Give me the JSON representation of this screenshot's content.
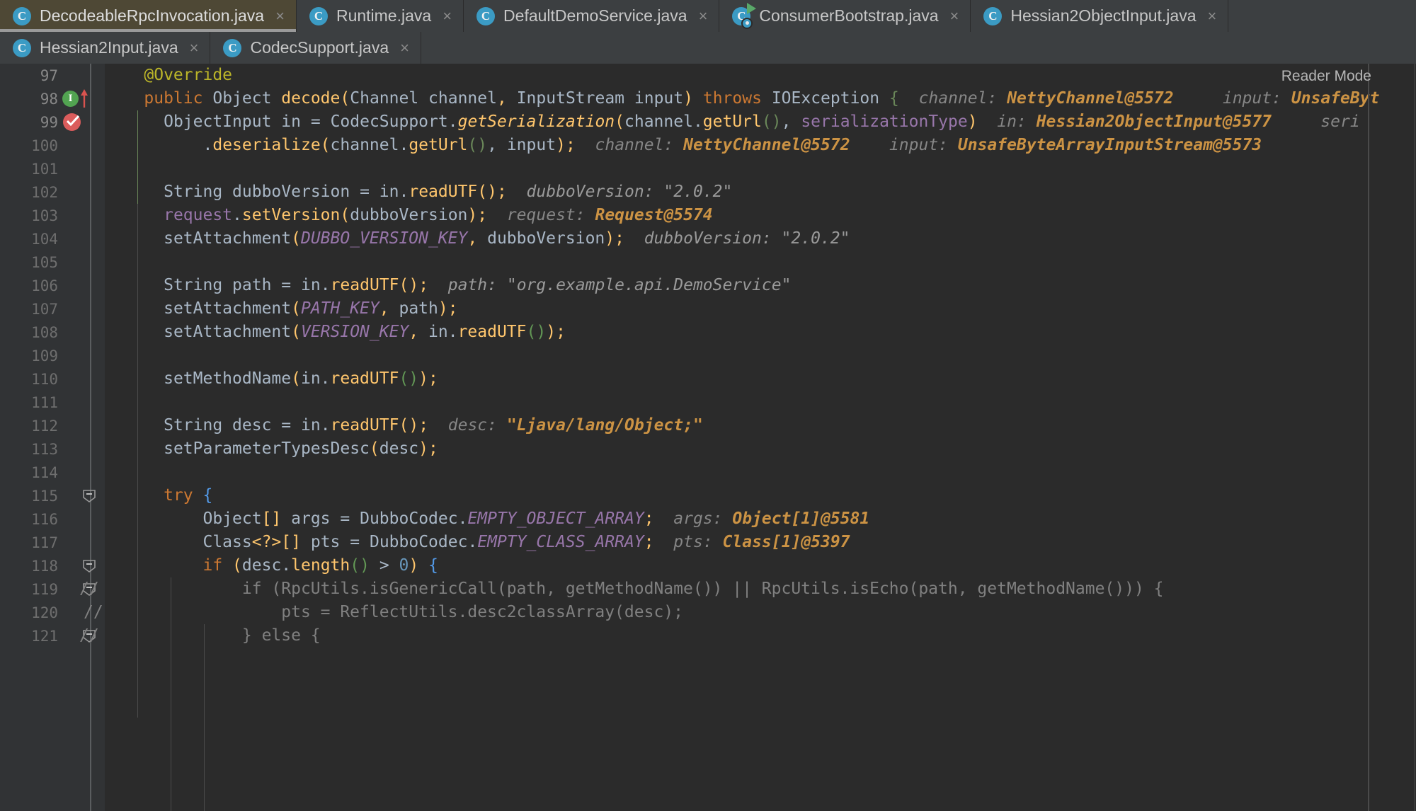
{
  "window": {
    "theme_background": "#2b2b2b",
    "gutter_background": "#313335",
    "active_tab_background": "#4e4835",
    "execution_line_background": "#3a2526",
    "accent_breakpoint": "#db5c5c"
  },
  "tabs": {
    "row1": [
      {
        "label": "DecodeableRpcInvocation.java",
        "icon": "java-class-icon",
        "active": true,
        "close_label": "×"
      },
      {
        "label": "Runtime.java",
        "icon": "java-class-icon",
        "active": false,
        "close_label": "×"
      },
      {
        "label": "DefaultDemoService.java",
        "icon": "java-class-icon",
        "active": false,
        "close_label": "×"
      },
      {
        "label": "ConsumerBootstrap.java",
        "icon": "java-runnable-class-icon",
        "active": false,
        "close_label": "×"
      },
      {
        "label": "Hessian2ObjectInput.java",
        "icon": "java-class-icon",
        "active": false,
        "close_label": "×"
      }
    ],
    "row2": [
      {
        "label": "Hessian2Input.java",
        "icon": "java-class-icon",
        "active": false,
        "close_label": "×"
      },
      {
        "label": "CodecSupport.java",
        "icon": "java-class-icon",
        "active": false,
        "close_label": "×"
      }
    ]
  },
  "editor": {
    "reader_mode_label": "Reader Mode",
    "first_line_number": 97,
    "gutter": {
      "implement_marker_line": 98,
      "implement_marker_glyph": "I",
      "breakpoint_line": 99,
      "breakpoint_state": "verified",
      "fold_lines": [
        98,
        115,
        118,
        119,
        121
      ]
    },
    "execution_line": 99,
    "lines": [
      {
        "n": 97,
        "indent": 2,
        "text": "@Override"
      },
      {
        "n": 98,
        "indent": 2,
        "text": "public Object decode(Channel channel, InputStream input) throws IOException {"
      },
      {
        "n": 99,
        "indent": 3,
        "text": "ObjectInput in = CodecSupport.getSerialization(channel.getUrl(), serializationType)"
      },
      {
        "n": 100,
        "indent": 5,
        "text": ".deserialize(channel.getUrl(), input);"
      },
      {
        "n": 101,
        "indent": 0,
        "text": ""
      },
      {
        "n": 102,
        "indent": 3,
        "text": "String dubboVersion = in.readUTF();"
      },
      {
        "n": 103,
        "indent": 3,
        "text": "request.setVersion(dubboVersion);"
      },
      {
        "n": 104,
        "indent": 3,
        "text": "setAttachment(DUBBO_VERSION_KEY, dubboVersion);"
      },
      {
        "n": 105,
        "indent": 0,
        "text": ""
      },
      {
        "n": 106,
        "indent": 3,
        "text": "String path = in.readUTF();"
      },
      {
        "n": 107,
        "indent": 3,
        "text": "setAttachment(PATH_KEY, path);"
      },
      {
        "n": 108,
        "indent": 3,
        "text": "setAttachment(VERSION_KEY, in.readUTF());"
      },
      {
        "n": 109,
        "indent": 0,
        "text": ""
      },
      {
        "n": 110,
        "indent": 3,
        "text": "setMethodName(in.readUTF());"
      },
      {
        "n": 111,
        "indent": 0,
        "text": ""
      },
      {
        "n": 112,
        "indent": 3,
        "text": "String desc = in.readUTF();"
      },
      {
        "n": 113,
        "indent": 3,
        "text": "setParameterTypesDesc(desc);"
      },
      {
        "n": 114,
        "indent": 0,
        "text": ""
      },
      {
        "n": 115,
        "indent": 3,
        "text": "try {"
      },
      {
        "n": 116,
        "indent": 4,
        "text": "Object[] args = DubboCodec.EMPTY_OBJECT_ARRAY;"
      },
      {
        "n": 117,
        "indent": 4,
        "text": "Class<?>[] pts = DubboCodec.EMPTY_CLASS_ARRAY;"
      },
      {
        "n": 118,
        "indent": 4,
        "text": "if (desc.length() > 0) {"
      },
      {
        "n": 119,
        "indent": 4,
        "text": "//            if (RpcUtils.isGenericCall(path, getMethodName()) || RpcUtils.isEcho(path, getMethodName())) {"
      },
      {
        "n": 120,
        "indent": 4,
        "text": "//                pts = ReflectUtils.desc2classArray(desc);"
      },
      {
        "n": 121,
        "indent": 4,
        "text": "//            } else {"
      }
    ],
    "inline_hints": [
      {
        "line": 98,
        "label": "channel:",
        "value": "NettyChannel@5572"
      },
      {
        "line": 98,
        "label": "input:",
        "value": "UnsafeByt"
      },
      {
        "line": 99,
        "label": "in:",
        "value": "Hessian2ObjectInput@5577"
      },
      {
        "line": 99,
        "label": "seri",
        "value": ""
      },
      {
        "line": 100,
        "label": "channel:",
        "value": "NettyChannel@5572"
      },
      {
        "line": 100,
        "label": "input:",
        "value": "UnsafeByteArrayInputStream@5573"
      },
      {
        "line": 102,
        "label": "dubboVersion:",
        "value": "\"2.0.2\""
      },
      {
        "line": 103,
        "label": "request:",
        "value": "Request@5574"
      },
      {
        "line": 104,
        "label": "dubboVersion:",
        "value": "\"2.0.2\""
      },
      {
        "line": 106,
        "label": "path:",
        "value": "\"org.example.api.DemoService\""
      },
      {
        "line": 112,
        "label": "desc:",
        "value": "\"Ljava/lang/Object;\""
      },
      {
        "line": 116,
        "label": "args:",
        "value": "Object[1]@5581"
      },
      {
        "line": 117,
        "label": "pts:",
        "value": "Class[1]@5397"
      }
    ]
  }
}
